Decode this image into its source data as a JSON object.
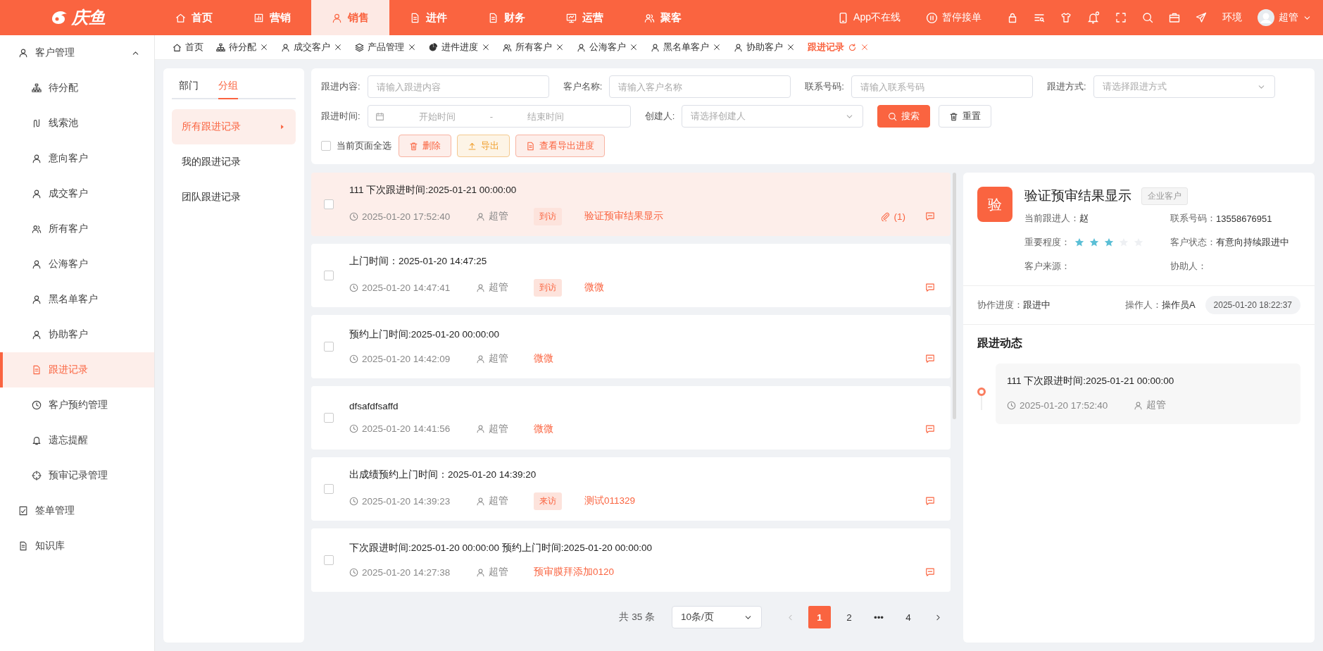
{
  "brand": {
    "logo_text": "庆鱼"
  },
  "nav": [
    {
      "label": "首页",
      "selected": false
    },
    {
      "label": "营销",
      "selected": false
    },
    {
      "label": "销售",
      "selected": true
    },
    {
      "label": "进件",
      "selected": false
    },
    {
      "label": "财务",
      "selected": false
    },
    {
      "label": "运营",
      "selected": false
    },
    {
      "label": "聚客",
      "selected": false
    }
  ],
  "header": {
    "actions": [
      {
        "label": "App不在线"
      },
      {
        "label": "暂停接单"
      }
    ],
    "env_label": "环境",
    "user": "超管"
  },
  "sidebar": {
    "items": [
      {
        "label": "客户管理",
        "selected": false,
        "expanded": true,
        "children": [
          {
            "label": "待分配",
            "selected": false
          },
          {
            "label": "线索池",
            "selected": false
          },
          {
            "label": "意向客户",
            "selected": false
          },
          {
            "label": "成交客户",
            "selected": false
          },
          {
            "label": "所有客户",
            "selected": false
          },
          {
            "label": "公海客户",
            "selected": false
          },
          {
            "label": "黑名单客户",
            "selected": false
          },
          {
            "label": "协助客户",
            "selected": false
          },
          {
            "label": "跟进记录",
            "selected": true
          },
          {
            "label": "客户预约管理",
            "selected": false
          },
          {
            "label": "遗忘提醒",
            "selected": false
          },
          {
            "label": "预审记录管理",
            "selected": false
          }
        ]
      },
      {
        "label": "签单管理",
        "selected": false
      },
      {
        "label": "知识库",
        "selected": false
      }
    ]
  },
  "page_tabs": [
    {
      "label": "首页",
      "selected": false,
      "closable": false
    },
    {
      "label": "待分配",
      "selected": false,
      "closable": true
    },
    {
      "label": "成交客户",
      "selected": false,
      "closable": true
    },
    {
      "label": "产品管理",
      "selected": false,
      "closable": true
    },
    {
      "label": "进件进度",
      "selected": false,
      "closable": true
    },
    {
      "label": "所有客户",
      "selected": false,
      "closable": true
    },
    {
      "label": "公海客户",
      "selected": false,
      "closable": true
    },
    {
      "label": "黑名单客户",
      "selected": false,
      "closable": true
    },
    {
      "label": "协助客户",
      "selected": false,
      "closable": true
    },
    {
      "label": "跟进记录",
      "selected": true,
      "closable": true
    }
  ],
  "group_panel": {
    "tabs": [
      {
        "label": "部门",
        "selected": false
      },
      {
        "label": "分组",
        "selected": true
      }
    ],
    "items": [
      {
        "label": "所有跟进记录",
        "selected": true
      },
      {
        "label": "我的跟进记录",
        "selected": false
      },
      {
        "label": "团队跟进记录",
        "selected": false
      }
    ]
  },
  "filters": {
    "fields": [
      {
        "kind": "text",
        "label": "跟进内容:",
        "placeholder": "请输入跟进内容"
      },
      {
        "kind": "text",
        "label": "客户名称:",
        "placeholder": "请输入客户名称"
      },
      {
        "kind": "text",
        "label": "联系号码:",
        "placeholder": "请输入联系号码"
      },
      {
        "kind": "select",
        "label": "跟进方式:",
        "placeholder": "请选择跟进方式"
      },
      {
        "kind": "daterange",
        "label": "跟进时间:",
        "start_placeholder": "开始时间",
        "separator": "-",
        "end_placeholder": "结束时间"
      },
      {
        "kind": "select",
        "label": "创建人:",
        "placeholder": "请选择创建人"
      }
    ],
    "search_button": "搜索",
    "reset_button": "重置",
    "select_all": {
      "label": "当前页面全选",
      "checked": false
    },
    "actions": [
      {
        "label": "删除",
        "kind": "danger"
      },
      {
        "label": "导出",
        "kind": "warning"
      },
      {
        "label": "查看导出进度",
        "kind": "danger"
      }
    ]
  },
  "records": [
    {
      "title": "111 下次跟进时间:2025-01-21 00:00:00",
      "time": "2025-01-20 17:52:40",
      "author": "超管",
      "tag": "到访",
      "customer": "验证预审结果显示",
      "attachment": "(1)",
      "selected": true,
      "checked": false
    },
    {
      "title": "上门时间：2025-01-20 14:47:25",
      "time": "2025-01-20 14:47:41",
      "author": "超管",
      "tag": "到访",
      "customer": "微微",
      "selected": false,
      "checked": false
    },
    {
      "title": "预约上门时间:2025-01-20 00:00:00",
      "time": "2025-01-20 14:42:09",
      "author": "超管",
      "customer": "微微",
      "selected": false,
      "checked": false
    },
    {
      "title": "dfsafdfsaffd",
      "time": "2025-01-20 14:41:56",
      "author": "超管",
      "customer": "微微",
      "selected": false,
      "checked": false
    },
    {
      "title": "出成绩预约上门时间：2025-01-20 14:39:20",
      "time": "2025-01-20 14:39:23",
      "author": "超管",
      "tag": "来访",
      "customer": "测试011329",
      "selected": false,
      "checked": false
    },
    {
      "title": "下次跟进时间:2025-01-20 00:00:00 预约上门时间:2025-01-20 00:00:00",
      "time": "2025-01-20 14:27:38",
      "author": "超管",
      "customer": "预审膜拜添加0120",
      "selected": false,
      "checked": false
    }
  ],
  "pagination": {
    "total": "共 35 条",
    "page_size": "10条/页",
    "pages": [
      {
        "kind": "page",
        "label": "1",
        "selected": true
      },
      {
        "kind": "page",
        "label": "2",
        "selected": false
      },
      {
        "kind": "ellipsis",
        "label": "•••"
      },
      {
        "kind": "page",
        "label": "4",
        "selected": false
      }
    ]
  },
  "detail": {
    "avatar": "验",
    "name": "验证预审结果显示",
    "type_tag": "企业客户",
    "fields": [
      {
        "kind": "text",
        "label": "当前跟进人：",
        "value": "赵"
      },
      {
        "kind": "text",
        "label": "联系号码：",
        "value": "13558676951"
      },
      {
        "kind": "stars",
        "label": "重要程度：",
        "stars": 3
      },
      {
        "kind": "text",
        "label": "客户状态：",
        "value": "有意向持续跟进中"
      },
      {
        "kind": "text",
        "label": "客户来源："
      },
      {
        "kind": "text",
        "label": "协助人："
      }
    ],
    "collab": {
      "progress_label": "协作进度：",
      "progress": "跟进中",
      "operator_label": "操作人：",
      "operator": "操作员A",
      "time": "2025-01-20 18:22:37"
    },
    "timeline_title": "跟进动态",
    "timeline": [
      {
        "title": "111 下次跟进时间:2025-01-21 00:00:00",
        "time": "2025-01-20 17:52:40",
        "author": "超管"
      }
    ]
  }
}
